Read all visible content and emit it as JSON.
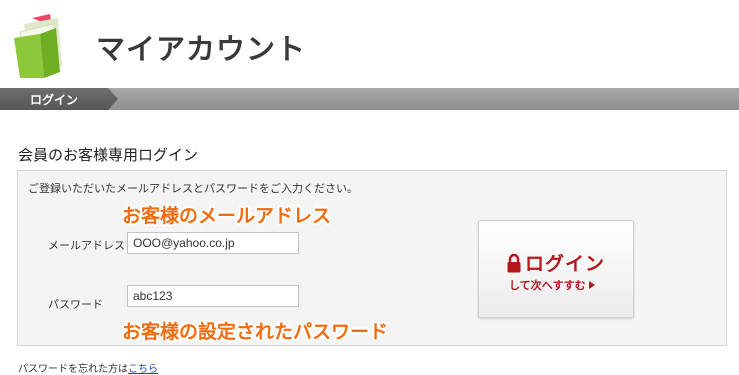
{
  "header": {
    "app_title": "マイアカウント",
    "logo_icon": "folder-icon"
  },
  "breadcrumb": {
    "current": "ログイン"
  },
  "section": {
    "title": "会員のお客様専用ログイン"
  },
  "form": {
    "instruction": "ご登録いただいたメールアドレスとパスワードをご入力ください。",
    "email_label": "メールアドレス",
    "email_value": "OOO@yahoo.co.jp",
    "password_label": "パスワード",
    "password_value": "abc123",
    "annotation_email": "お客様のメールアドレス",
    "annotation_password": "お客様の設定されたパスワード",
    "login_button": {
      "main_label": "ログイン",
      "sub_label": "して次へすすむ",
      "icon": "lock-icon",
      "arrow_icon": "play-icon"
    }
  },
  "forgot": {
    "text": "パスワードを忘れた方は",
    "link": "こちら"
  },
  "colors": {
    "accent_orange": "#f26b0f",
    "button_red": "#b4161b",
    "link_blue": "#1a3fd6",
    "logo_green": "#8cc83a",
    "logo_pink": "#e84a6a"
  }
}
